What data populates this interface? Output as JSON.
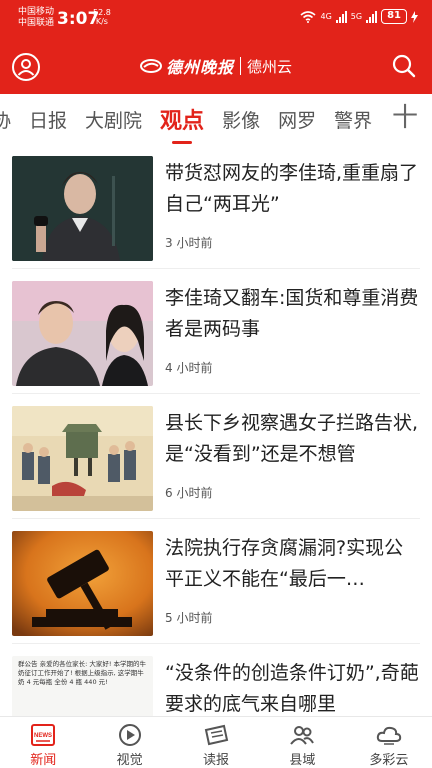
{
  "status_bar": {
    "carrier_1": "中国移动",
    "carrier_2": "中国联通",
    "time": "3:07",
    "speed_value": "52.8",
    "speed_unit": "K/s",
    "network_1": "4G",
    "network_2": "5G",
    "battery": "81"
  },
  "header": {
    "logo_main": "德州晚报",
    "logo_sub": "德州云",
    "brand_color": "#e2231a"
  },
  "tabs": {
    "items": [
      {
        "label": "协"
      },
      {
        "label": "日报"
      },
      {
        "label": "大剧院"
      },
      {
        "label": "观点"
      },
      {
        "label": "影像"
      },
      {
        "label": "网罗"
      },
      {
        "label": "警界"
      }
    ],
    "active": "观点",
    "add_label": "十"
  },
  "news": {
    "items": [
      {
        "title": "带货怼网友的李佳琦,重重扇了自己“两耳光”",
        "time": "3 小时前"
      },
      {
        "title": "李佳琦又翻车:国货和尊重消费者是两码事",
        "time": "4 小时前"
      },
      {
        "title": "县长下乡视察遇女子拦路告状,是“没看到”还是不想管",
        "time": "6 小时前"
      },
      {
        "title": "法院执行存贪腐漏洞?实现公平正义不能在“最后一…",
        "time": "5 小时前"
      },
      {
        "title": "“没条件的创造条件订奶”,奇葩要求的底气来自哪里",
        "time": ""
      }
    ],
    "thumb_texts": {
      "note": "群公告 亲爱的各位家长: 大家好! 本学期的牛奶征订工作开始了! 根据上级指示, 这学期牛奶 4 元每瓶 全份 4 瓶 440 元!"
    }
  },
  "bottom_nav": {
    "items": [
      {
        "label": "新闻",
        "icon": "news-icon"
      },
      {
        "label": "视觉",
        "icon": "play-icon"
      },
      {
        "label": "读报",
        "icon": "newspaper-icon"
      },
      {
        "label": "县域",
        "icon": "people-icon"
      },
      {
        "label": "多彩云",
        "icon": "cloud-icon"
      }
    ],
    "news_icon_text": "NEWS",
    "active": "新闻"
  }
}
